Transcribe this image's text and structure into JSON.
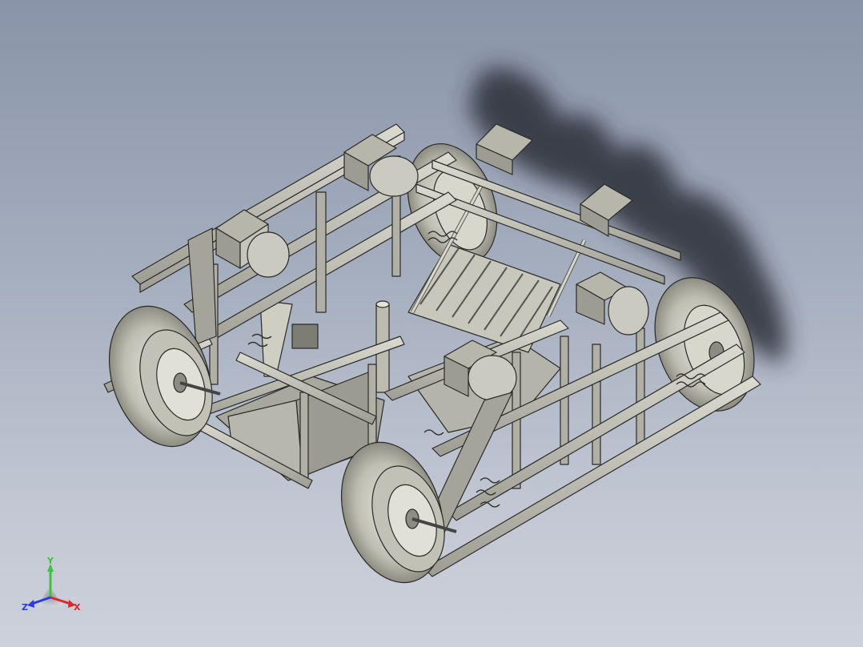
{
  "viewport": {
    "background_top": "#8994a8",
    "background_bottom": "#cdd1db"
  },
  "model": {
    "frame_color": "#c9c8bd",
    "edge_color": "#2a2a28",
    "shadow_color": "#2c2f38"
  },
  "triad": {
    "x_label": "X",
    "y_label": "Y",
    "z_label": "Z",
    "x_color": "#e0262a",
    "y_color": "#3cc43c",
    "z_color": "#2a3ce0"
  }
}
